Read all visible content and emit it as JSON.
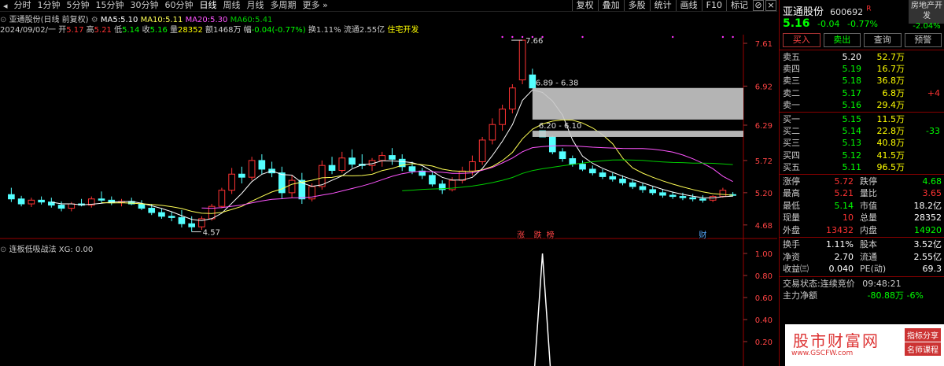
{
  "timeframes": [
    "分时",
    "1分钟",
    "5分钟",
    "15分钟",
    "30分钟",
    "60分钟",
    "日线",
    "周线",
    "月线",
    "多周期",
    "更多"
  ],
  "toolbar_right": [
    "复权",
    "叠加",
    "多股",
    "统计",
    "画线",
    "F10",
    "标记"
  ],
  "ma_line": {
    "name": "亚通股份(日线 前复权)",
    "ma5_label": "MA5:",
    "ma5": "5.10",
    "ma10_label": "MA10:",
    "ma10": "5.11",
    "ma20_label": "MA20:",
    "ma20": "5.30",
    "ma60_label": "MA60:",
    "ma60": "5.41"
  },
  "info_line": {
    "date": "2024/09/02/一",
    "open_label": "开",
    "open": "5.17",
    "high_label": "高",
    "high": "5.21",
    "low_label": "低",
    "low": "5.14",
    "close_label": "收",
    "close": "5.16",
    "vol_label": "量",
    "vol": "28352",
    "amt_label": "额",
    "amt": "1468万",
    "chg_label": "幅",
    "chg": "-0.04(-0.77%)",
    "turn": "换1.11%",
    "float": "流通2.55亿",
    "sector": "住宅开发"
  },
  "sub_indicator": {
    "name": "连板低吸战法",
    "value": "XG: 0.00"
  },
  "price_axis": [
    "7.61",
    "6.92",
    "6.29",
    "5.72",
    "5.20",
    "4.68"
  ],
  "sub_axis": [
    "1.00",
    "0.80",
    "0.60",
    "0.40",
    "0.20"
  ],
  "annotations": {
    "high": "7.66",
    "low": "4.57",
    "gap1": "6.89 - 6.38",
    "gap2": "6.20 - 6.10",
    "markers": [
      "涨",
      "跌",
      "榜",
      "财"
    ]
  },
  "colors": {
    "up": "#ff3333",
    "down": "#54ffff",
    "ma5": "#ffffff",
    "ma10": "#ffff55",
    "ma20": "#ff55ff",
    "ma60": "#00cc00"
  },
  "chart_data": {
    "type": "candlestick",
    "ylim": [
      4.5,
      7.75
    ],
    "candles": [
      [
        5.17,
        5.28,
        5.05,
        5.1
      ],
      [
        5.1,
        5.15,
        4.98,
        5.02
      ],
      [
        5.02,
        5.12,
        4.97,
        5.08
      ],
      [
        5.08,
        5.14,
        5.01,
        5.05
      ],
      [
        5.05,
        5.12,
        4.96,
        5.0
      ],
      [
        5.0,
        5.06,
        4.9,
        4.95
      ],
      [
        4.95,
        5.05,
        4.9,
        5.02
      ],
      [
        5.02,
        5.1,
        4.98,
        5.0
      ],
      [
        5.0,
        5.14,
        4.96,
        5.1
      ],
      [
        5.1,
        5.22,
        5.03,
        5.08
      ],
      [
        5.08,
        5.14,
        5.0,
        5.04
      ],
      [
        5.04,
        5.1,
        4.98,
        5.06
      ],
      [
        5.06,
        5.12,
        5.0,
        5.02
      ],
      [
        5.02,
        5.08,
        4.92,
        4.95
      ],
      [
        4.95,
        5.02,
        4.84,
        4.88
      ],
      [
        4.88,
        4.95,
        4.78,
        4.82
      ],
      [
        4.82,
        4.9,
        4.74,
        4.8
      ],
      [
        4.8,
        4.92,
        4.64,
        4.7
      ],
      [
        4.7,
        4.82,
        4.57,
        4.65
      ],
      [
        4.65,
        4.82,
        4.6,
        4.78
      ],
      [
        4.78,
        5.02,
        4.75,
        4.98
      ],
      [
        4.98,
        5.28,
        4.95,
        5.24
      ],
      [
        5.24,
        5.6,
        5.18,
        5.5
      ],
      [
        5.5,
        5.62,
        5.35,
        5.45
      ],
      [
        5.45,
        5.78,
        5.4,
        5.72
      ],
      [
        5.72,
        5.82,
        5.5,
        5.58
      ],
      [
        5.58,
        5.7,
        5.45,
        5.52
      ],
      [
        5.52,
        5.62,
        5.1,
        5.2
      ],
      [
        5.2,
        5.48,
        5.12,
        5.4
      ],
      [
        5.4,
        5.52,
        5.02,
        5.1
      ],
      [
        5.1,
        5.35,
        5.06,
        5.3
      ],
      [
        5.3,
        5.72,
        5.25,
        5.64
      ],
      [
        5.64,
        5.78,
        5.5,
        5.56
      ],
      [
        5.56,
        5.86,
        5.52,
        5.76
      ],
      [
        5.76,
        5.9,
        5.6,
        5.66
      ],
      [
        5.66,
        5.82,
        5.58,
        5.64
      ],
      [
        5.64,
        5.76,
        5.55,
        5.72
      ],
      [
        5.72,
        5.86,
        5.62,
        5.8
      ],
      [
        5.8,
        5.92,
        5.65,
        5.74
      ],
      [
        5.74,
        5.82,
        5.55,
        5.62
      ],
      [
        5.62,
        5.7,
        5.5,
        5.55
      ],
      [
        5.55,
        5.6,
        5.42,
        5.48
      ],
      [
        5.48,
        5.55,
        5.3,
        5.34
      ],
      [
        5.34,
        5.4,
        5.18,
        5.25
      ],
      [
        5.25,
        5.45,
        5.22,
        5.4
      ],
      [
        5.4,
        5.62,
        5.35,
        5.55
      ],
      [
        5.55,
        5.8,
        5.48,
        5.7
      ],
      [
        5.7,
        6.1,
        5.65,
        6.05
      ],
      [
        6.05,
        6.4,
        5.98,
        6.3
      ],
      [
        6.3,
        6.62,
        6.2,
        6.55
      ],
      [
        6.55,
        6.95,
        6.48,
        6.89
      ],
      [
        7.02,
        7.66,
        6.95,
        7.66
      ],
      [
        7.1,
        7.2,
        6.89,
        6.89
      ],
      [
        6.2,
        6.2,
        6.1,
        6.1
      ],
      [
        6.1,
        6.12,
        5.82,
        5.86
      ],
      [
        5.86,
        5.92,
        5.7,
        5.75
      ],
      [
        5.75,
        5.8,
        5.62,
        5.66
      ],
      [
        5.66,
        5.72,
        5.55,
        5.58
      ],
      [
        5.58,
        5.64,
        5.48,
        5.52
      ],
      [
        5.52,
        5.58,
        5.42,
        5.46
      ],
      [
        5.46,
        5.52,
        5.38,
        5.42
      ],
      [
        5.42,
        5.48,
        5.32,
        5.36
      ],
      [
        5.36,
        5.42,
        5.26,
        5.3
      ],
      [
        5.3,
        5.36,
        5.2,
        5.25
      ],
      [
        5.25,
        5.3,
        5.16,
        5.2
      ],
      [
        5.2,
        5.26,
        5.12,
        5.16
      ],
      [
        5.16,
        5.22,
        5.1,
        5.14
      ],
      [
        5.14,
        5.2,
        5.08,
        5.12
      ],
      [
        5.12,
        5.18,
        5.06,
        5.1
      ],
      [
        5.1,
        5.16,
        5.04,
        5.08
      ],
      [
        5.08,
        5.16,
        5.05,
        5.14
      ],
      [
        5.14,
        5.28,
        5.12,
        5.24
      ],
      [
        5.17,
        5.21,
        5.14,
        5.16
      ]
    ],
    "xg_signal_index": 53,
    "xg_signal_value": 1.0
  },
  "sidebar": {
    "name": "亚通股份",
    "code": "600692",
    "r_tag": "R",
    "sector": "房地产开发",
    "price": "5.16",
    "change": "-0.04",
    "pct": "-0.77%",
    "sector_pct": "-2.04%",
    "buttons": [
      "买入",
      "卖出",
      "查询",
      "预警"
    ],
    "sells": [
      {
        "label": "卖五",
        "pr": "5.20",
        "vol": "52.7万",
        "ex": ""
      },
      {
        "label": "卖四",
        "pr": "5.19",
        "vol": "16.7万",
        "ex": ""
      },
      {
        "label": "卖三",
        "pr": "5.18",
        "vol": "36.8万",
        "ex": ""
      },
      {
        "label": "卖二",
        "pr": "5.17",
        "vol": "6.8万",
        "ex": "+4"
      },
      {
        "label": "卖一",
        "pr": "5.16",
        "vol": "29.4万",
        "ex": ""
      }
    ],
    "buys": [
      {
        "label": "买一",
        "pr": "5.15",
        "vol": "11.5万",
        "ex": ""
      },
      {
        "label": "买二",
        "pr": "5.14",
        "vol": "22.8万",
        "ex": "-33"
      },
      {
        "label": "买三",
        "pr": "5.13",
        "vol": "40.8万",
        "ex": ""
      },
      {
        "label": "买四",
        "pr": "5.12",
        "vol": "41.5万",
        "ex": ""
      },
      {
        "label": "买五",
        "pr": "5.11",
        "vol": "96.5万",
        "ex": ""
      }
    ],
    "stats1": [
      [
        "涨停",
        "5.72",
        "跌停",
        "4.68"
      ],
      [
        "最高",
        "5.21",
        "量比",
        "3.65"
      ],
      [
        "最低",
        "5.14",
        "市值",
        "18.2亿"
      ],
      [
        "现量",
        "10",
        "总量",
        "28352"
      ],
      [
        "外盘",
        "13432",
        "内盘",
        "14920"
      ]
    ],
    "stats2": [
      [
        "换手",
        "1.11%",
        "股本",
        "3.52亿"
      ],
      [
        "净资",
        "2.70",
        "流通",
        "2.55亿"
      ],
      [
        "收益㈢",
        "0.040",
        "PE(动)",
        "69.3"
      ]
    ],
    "trade_state_label": "交易状态:",
    "trade_state": "连续竞价",
    "time": "09:48:21",
    "main_flow_label": "主力净额",
    "main_flow": "-80.88万",
    "main_flow_pct": "-6%"
  },
  "watermark": {
    "main": "股市财富网",
    "url": "www.GSCFW.com",
    "tag1": "指标分享",
    "tag2": "名师课程"
  }
}
